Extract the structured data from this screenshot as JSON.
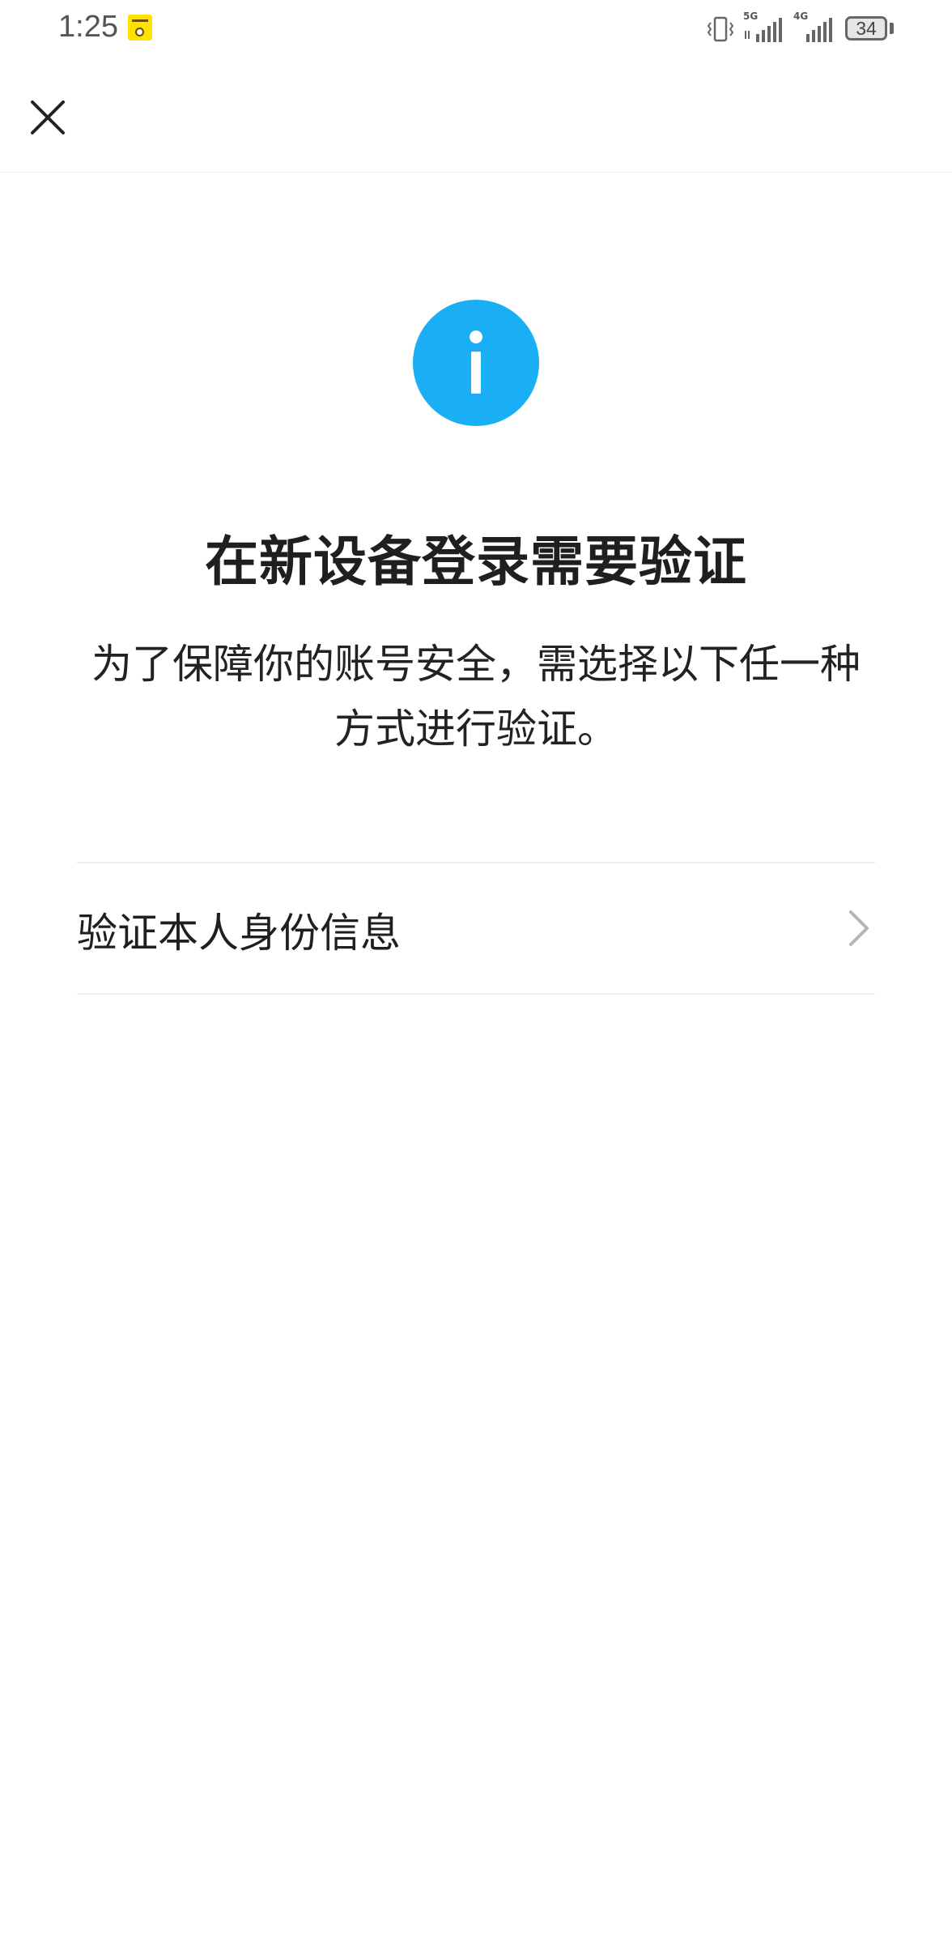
{
  "status_bar": {
    "time": "1:25",
    "network_1": "5G",
    "network_2": "4G",
    "battery_level": "34",
    "icons": [
      "app-notification-icon",
      "vibrate-icon",
      "signal-icon",
      "signal-icon",
      "battery-icon"
    ]
  },
  "nav": {
    "close_icon": "close-icon"
  },
  "main": {
    "icon": "info-icon",
    "accent_color": "#1aaef5",
    "title": "在新设备登录需要验证",
    "description": "为了保障你的账号安全，需选择以下任一种方式进行验证。"
  },
  "options": [
    {
      "label": "验证本人身份信息",
      "icon": "chevron-right-icon"
    }
  ]
}
